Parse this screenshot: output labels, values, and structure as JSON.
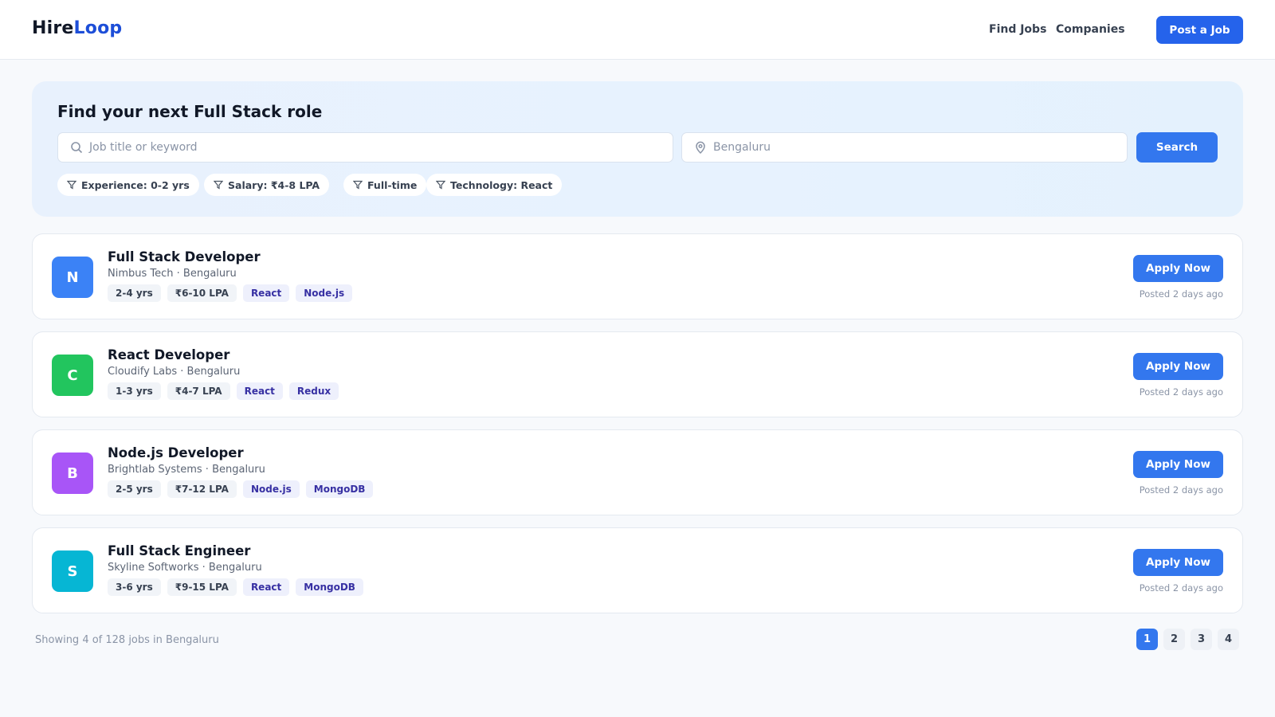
{
  "header": {
    "logo_part1": "Hire",
    "logo_part2": "Loop",
    "nav": [
      "Find Jobs",
      "Companies"
    ],
    "post_job_label": "Post a Job"
  },
  "search": {
    "title": "Find your next Full Stack role",
    "keyword_placeholder": "Job title or keyword",
    "location_placeholder": "Bengaluru",
    "button_label": "Search",
    "filters": [
      "Experience: 0-2 yrs",
      "Salary: ₹4-8 LPA",
      "Full-time",
      "Technology: React"
    ]
  },
  "jobs": [
    {
      "initial": "N",
      "avatar_color": "#3b82f6",
      "title": "Full Stack Developer",
      "company": "Nimbus Tech",
      "location": "Bengaluru",
      "meta": "Nimbus Tech · Bengaluru",
      "experience": "2-4 yrs",
      "salary": "₹6-10 LPA",
      "skills": [
        "React",
        "Node.js"
      ],
      "apply_label": "Apply Now",
      "posted": "Posted 2 days ago"
    },
    {
      "initial": "C",
      "avatar_color": "#22c55e",
      "title": "React Developer",
      "company": "Cloudify Labs",
      "location": "Bengaluru",
      "meta": "Cloudify Labs · Bengaluru",
      "experience": "1-3 yrs",
      "salary": "₹4-7 LPA",
      "skills": [
        "React",
        "Redux"
      ],
      "apply_label": "Apply Now",
      "posted": "Posted 2 days ago"
    },
    {
      "initial": "B",
      "avatar_color": "#a855f7",
      "title": "Node.js Developer",
      "company": "Brightlab Systems",
      "location": "Bengaluru",
      "meta": "Brightlab Systems · Bengaluru",
      "experience": "2-5 yrs",
      "salary": "₹7-12 LPA",
      "skills": [
        "Node.js",
        "MongoDB"
      ],
      "apply_label": "Apply Now",
      "posted": "Posted 2 days ago"
    },
    {
      "initial": "S",
      "avatar_color": "#06b6d4",
      "title": "Full Stack Engineer",
      "company": "Skyline Softworks",
      "location": "Bengaluru",
      "meta": "Skyline Softworks · Bengaluru",
      "experience": "3-6 yrs",
      "salary": "₹9-15 LPA",
      "skills": [
        "React",
        "MongoDB"
      ],
      "apply_label": "Apply Now",
      "posted": "Posted 2 days ago"
    }
  ],
  "footer": {
    "summary": "Showing 4 of 128 jobs in Bengaluru",
    "pages": [
      "1",
      "2",
      "3",
      "4"
    ],
    "active_page": "1"
  },
  "colors": {
    "accent": "#3377ee",
    "brand": "#1d4ed8"
  },
  "icons": {
    "search_field": "search-icon",
    "location_field": "map-pin-icon",
    "filter_chip": "filter-icon"
  }
}
